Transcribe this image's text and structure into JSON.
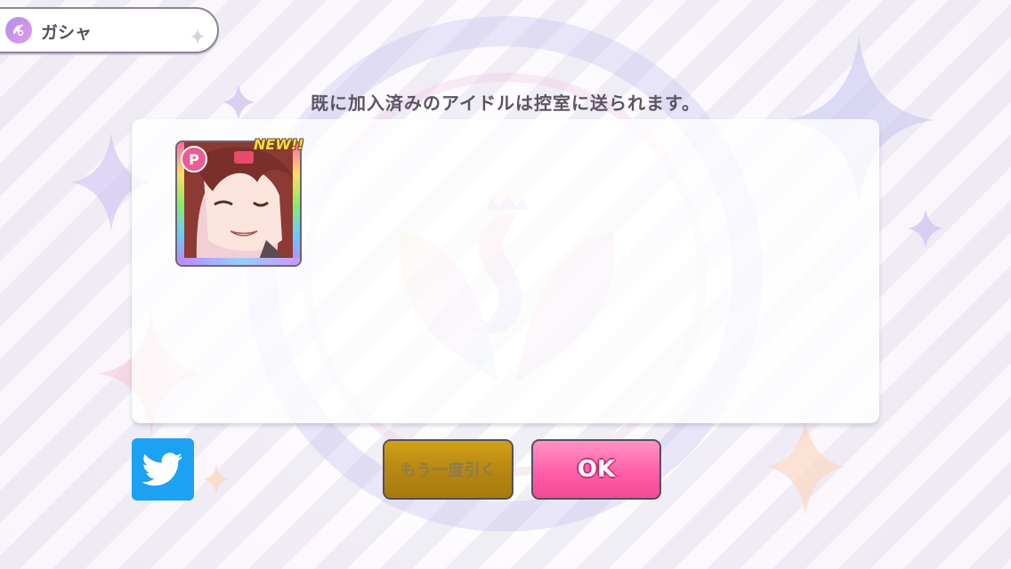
{
  "header": {
    "title": "ガシャ",
    "icon": "gacha-wing-icon"
  },
  "message": "既に加入済みのアイドルは控室に送られます。",
  "result_card": {
    "type_badge": "P",
    "new_label": "NEW!!"
  },
  "buttons": {
    "share_icon": "twitter-bird-icon",
    "draw_again_label": "もう一度引く",
    "ok_label": "OK"
  },
  "colors": {
    "ok_button": "#ff5fa8",
    "draw_again_button": "#b78812",
    "twitter": "#1da1f2",
    "type_badge": "#ea5c93"
  }
}
